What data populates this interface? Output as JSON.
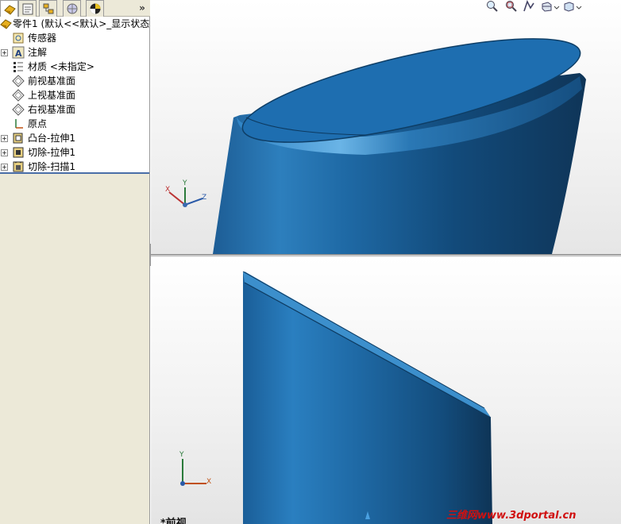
{
  "panel": {
    "more_glyph": "»",
    "tabs": [
      {
        "name": "featuremanager-tab",
        "icon": "feature-tree-icon"
      },
      {
        "name": "propertymanager-tab",
        "icon": "property-icon"
      },
      {
        "name": "configurationmanager-tab",
        "icon": "configuration-icon"
      },
      {
        "name": "dimxpert-tab",
        "icon": "dimxpert-icon"
      },
      {
        "name": "display-manager-tab",
        "icon": "display-icon"
      }
    ]
  },
  "tree": {
    "root": {
      "label": "零件1  (默认<<默认>_显示状态",
      "icon": "part-icon"
    },
    "items": [
      {
        "label": "传感器",
        "icon": "sensor-icon",
        "expandable": false
      },
      {
        "label": "注解",
        "icon": "annotation-icon",
        "expandable": true
      },
      {
        "label": "材质 <未指定>",
        "icon": "material-icon",
        "expandable": false
      },
      {
        "label": "前视基准面",
        "icon": "plane-icon",
        "expandable": false
      },
      {
        "label": "上视基准面",
        "icon": "plane-icon",
        "expandable": false
      },
      {
        "label": "右视基准面",
        "icon": "plane-icon",
        "expandable": false
      },
      {
        "label": "原点",
        "icon": "origin-icon",
        "expandable": false
      },
      {
        "label": "凸台-拉伸1",
        "icon": "boss-extrude-icon",
        "expandable": true
      },
      {
        "label": "切除-拉伸1",
        "icon": "cut-extrude-icon",
        "expandable": true
      },
      {
        "label": "切除-扫描1",
        "icon": "cut-sweep-icon",
        "expandable": true
      }
    ]
  },
  "viewports": {
    "top": {
      "triad": {
        "x": "X",
        "y": "Y",
        "z": "Z"
      }
    },
    "bottom": {
      "triad": {
        "x": "X",
        "y": "Y"
      },
      "view_name": "*前视"
    }
  },
  "view_toolbar": [
    "zoom-to-fit-icon",
    "zoom-to-area-icon",
    "previous-view-icon",
    "section-view-icon",
    "view-orientation-icon",
    "display-style-icon"
  ],
  "watermark": "三维网www.3dportal.cn",
  "colors": {
    "part_blue": "#1a6aa8",
    "panel_bg": "#ece9d8",
    "tree_border": "#4a6ea8"
  }
}
